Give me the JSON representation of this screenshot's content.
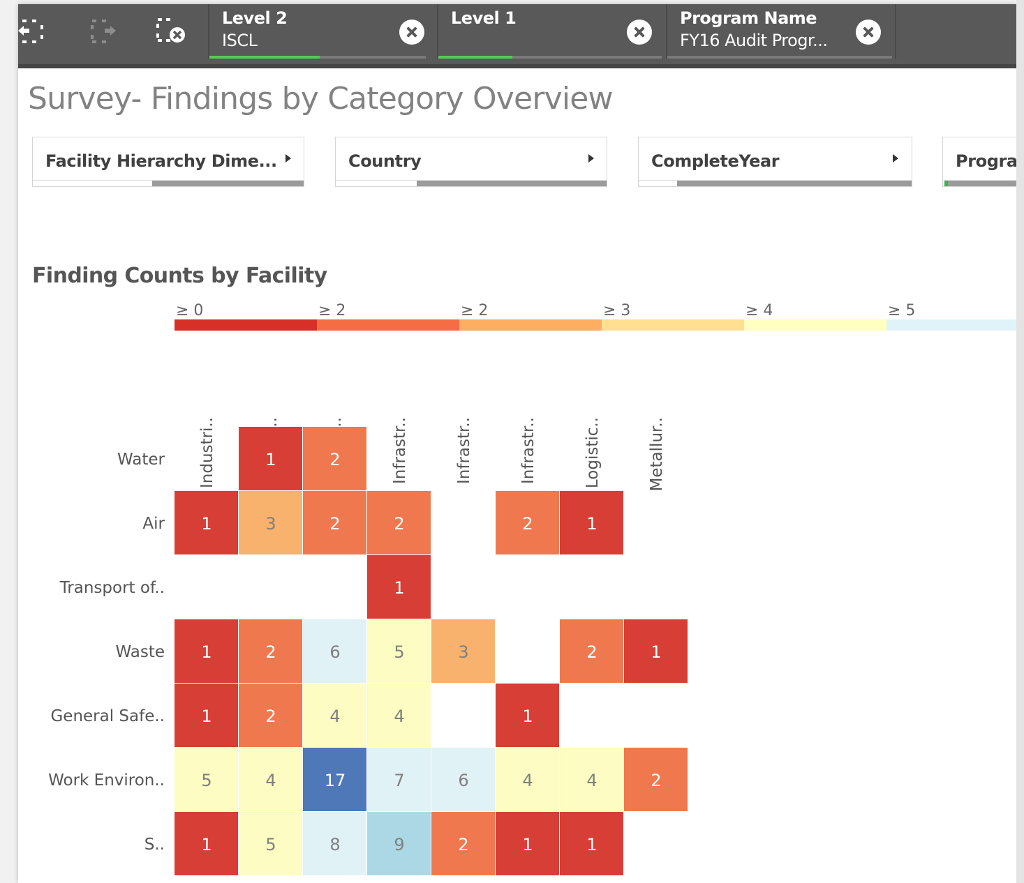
{
  "toolbar": {
    "icons": [
      "step-back-icon",
      "step-forward-icon",
      "clear-all-selections-icon"
    ],
    "selections": [
      {
        "field": "Level 2",
        "value": "ISCL",
        "progress": 0.51
      },
      {
        "field": "Level 1",
        "value": "",
        "progress": 0.33
      },
      {
        "field": "Program Name",
        "value": "FY16 Audit Progr...",
        "progress": 1.0
      }
    ]
  },
  "page": {
    "title": "Survey- Findings by Category Overview"
  },
  "filters": [
    {
      "label": "Facility Hierarchy Dime...",
      "selected_fraction": 0.44
    },
    {
      "label": "Country",
      "selected_fraction": 0.3
    },
    {
      "label": "CompleteYear",
      "selected_fraction": 0.14
    },
    {
      "label": "Progra",
      "selected_fraction": 0.05
    }
  ],
  "chart_data": {
    "type": "heatmap",
    "title": "Finding Counts by Facility",
    "legend": {
      "position": "top",
      "labels": [
        "≥ 0",
        "≥ 2",
        "≥ 2",
        "≥ 3",
        "≥ 4",
        "≥ 5"
      ],
      "colors": [
        "#d73027",
        "#f46d43",
        "#fdae61",
        "#fee090",
        "#ffffbf",
        "#e0f3f8"
      ]
    },
    "x_categories": [
      "Industri..",
      "Industri..",
      "Industri..",
      "Infrastr..",
      "Infrastr..",
      "Infrastr..",
      "Logistic..",
      "Metallur.."
    ],
    "y_categories": [
      "Water",
      "Air",
      "Transport of..",
      "Waste",
      "General Safe..",
      "Work Environ..",
      "S.."
    ],
    "values": [
      [
        null,
        1,
        2,
        null,
        null,
        null,
        null,
        null
      ],
      [
        1,
        3,
        2,
        2,
        null,
        2,
        1,
        null
      ],
      [
        null,
        null,
        null,
        1,
        null,
        null,
        null,
        null
      ],
      [
        1,
        2,
        6,
        5,
        3,
        null,
        2,
        1
      ],
      [
        1,
        2,
        4,
        4,
        null,
        1,
        null,
        null
      ],
      [
        5,
        4,
        17,
        7,
        6,
        4,
        4,
        2
      ],
      [
        1,
        5,
        8,
        9,
        2,
        1,
        1,
        null
      ]
    ],
    "color_scale": {
      "1": "#d73e36",
      "2": "#f0784f",
      "3": "#f9b26d",
      "4": "#fdfcc3",
      "5": "#fdfcc3",
      "6": "#e1f2f6",
      "7": "#e1f2f6",
      "8": "#e1f2f6",
      "9": "#acd8e6",
      "17": "#4e78b8"
    },
    "light_text_color": "#ffffff",
    "dark_text_color": "#7f7f7f"
  }
}
